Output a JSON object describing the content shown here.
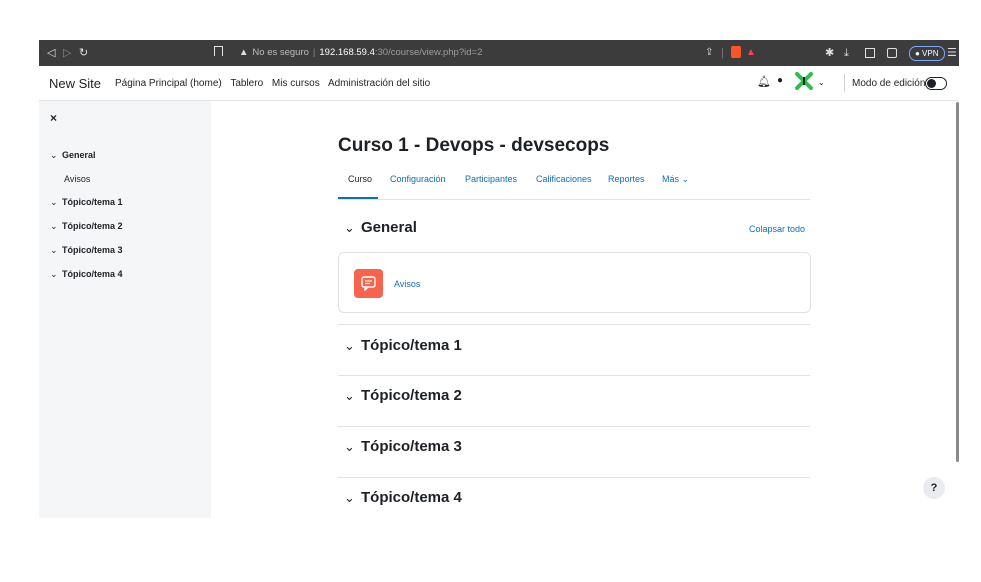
{
  "browser": {
    "security_text": "No es seguro",
    "host": "192.168.59.4",
    "path": ":30/course/view.php?id=2",
    "vpn_label": "● VPN",
    "icons": [
      "back-icon",
      "forward-icon",
      "reload-icon",
      "bookmark-icon",
      "warning-icon",
      "share-icon",
      "brave-shield-icon",
      "brave-rewards-icon",
      "extensions-icon",
      "download-icon",
      "sidebar-icon",
      "wallet-icon",
      "menu-icon"
    ]
  },
  "navbar": {
    "site_name": "New Site",
    "links": [
      "Página Principal (home)",
      "Tablero",
      "Mis cursos",
      "Administración del sitio"
    ],
    "edit_mode_label": "Modo de edición",
    "icons": [
      "bell-icon",
      "chat-icon",
      "user-avatar-icon",
      "chevron-down-icon"
    ]
  },
  "drawer": {
    "close_icon": "×",
    "items": [
      {
        "label": "General",
        "type": "section"
      },
      {
        "label": "Avisos",
        "type": "activity"
      },
      {
        "label": "Tópico/tema 1",
        "type": "section"
      },
      {
        "label": "Tópico/tema 2",
        "type": "section"
      },
      {
        "label": "Tópico/tema 3",
        "type": "section"
      },
      {
        "label": "Tópico/tema 4",
        "type": "section"
      }
    ]
  },
  "course": {
    "title": "Curso 1 - Devops - devsecops",
    "tabs": [
      "Curso",
      "Configuración",
      "Participantes",
      "Calificaciones",
      "Reportes",
      "Más ⌄"
    ],
    "active_tab": "Curso",
    "collapse_all": "Colapsar todo",
    "sections": [
      {
        "title": "General",
        "activities": [
          {
            "name": "Avisos",
            "icon": "forum-icon"
          }
        ]
      },
      {
        "title": "Tópico/tema 1"
      },
      {
        "title": "Tópico/tema 2"
      },
      {
        "title": "Tópico/tema 3"
      },
      {
        "title": "Tópico/tema 4"
      }
    ]
  },
  "help_label": "?",
  "colors": {
    "accent": "#0f6cbf",
    "forum": "#f7634d",
    "drawer_bg": "#f5f6f7",
    "chrome_bg": "#3c3c3c"
  }
}
